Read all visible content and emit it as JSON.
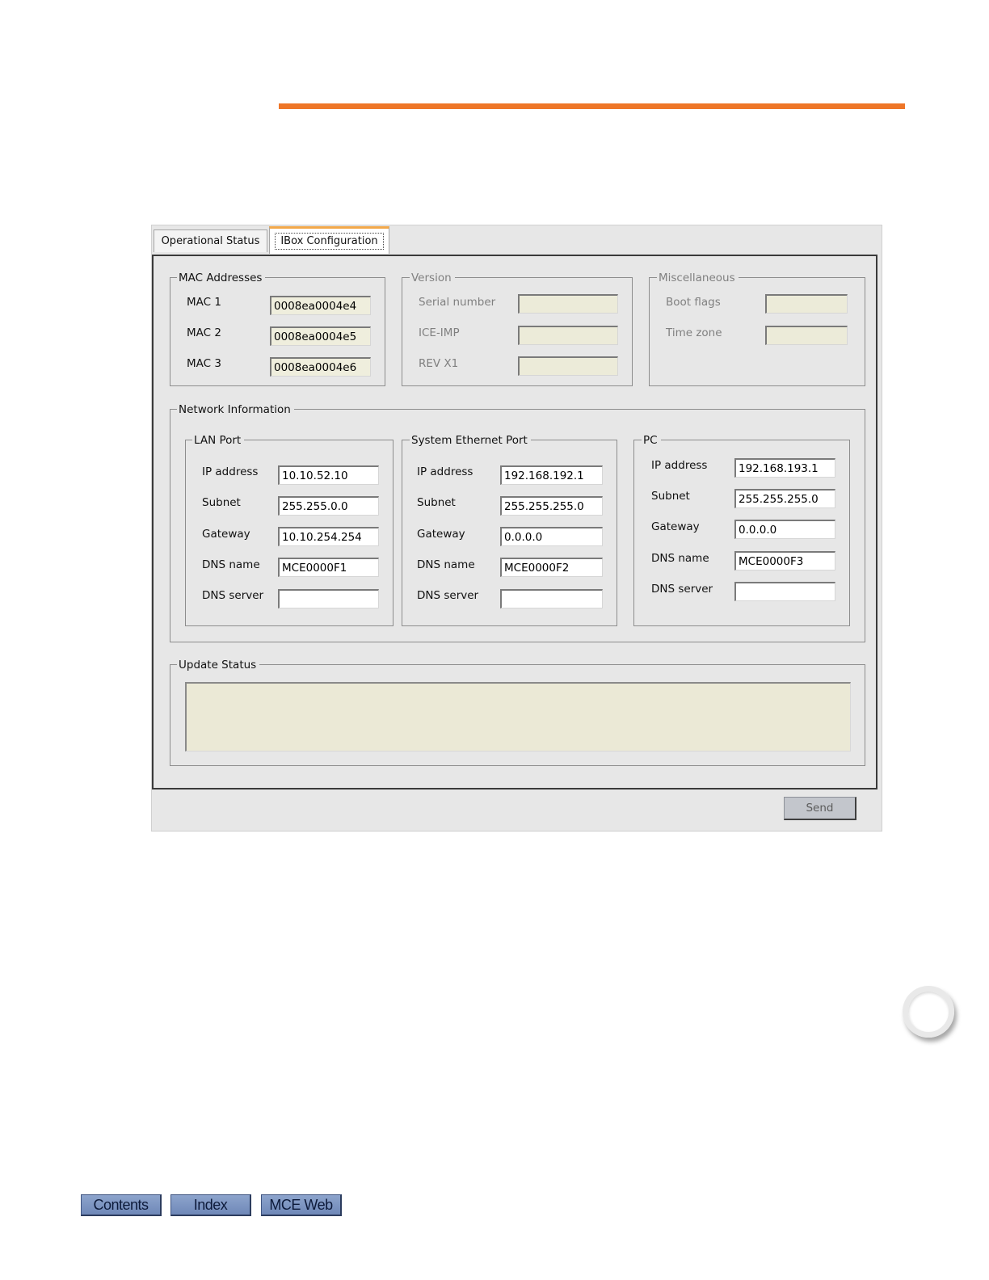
{
  "colors": {
    "accent_rule": "#ee7628",
    "tab_highlight": "#f2a84a",
    "nav_button": "#7b93c0",
    "readonly_field": "#efeedd"
  },
  "tabs": [
    {
      "label": "Operational Status",
      "selected": false
    },
    {
      "label": "IBox Configuration",
      "selected": true
    }
  ],
  "mac": {
    "title": "MAC Addresses",
    "rows": [
      {
        "label": "MAC 1",
        "value": "0008ea0004e4"
      },
      {
        "label": "MAC 2",
        "value": "0008ea0004e5"
      },
      {
        "label": "MAC 3",
        "value": "0008ea0004e6"
      }
    ]
  },
  "version": {
    "title": "Version",
    "rows": [
      {
        "label": "Serial number",
        "value": ""
      },
      {
        "label": "ICE-IMP",
        "value": ""
      },
      {
        "label": "REV X1",
        "value": ""
      }
    ]
  },
  "misc": {
    "title": "Miscellaneous",
    "rows": [
      {
        "label": "Boot flags",
        "value": ""
      },
      {
        "label": "Time zone",
        "value": ""
      }
    ]
  },
  "network": {
    "title": "Network Information",
    "lan": {
      "title": "LAN Port",
      "rows": [
        {
          "label": "IP address",
          "value": "10.10.52.10"
        },
        {
          "label": "Subnet",
          "value": "255.255.0.0"
        },
        {
          "label": "Gateway",
          "value": "10.10.254.254"
        },
        {
          "label": "DNS name",
          "value": "MCE0000F1"
        },
        {
          "label": "DNS server",
          "value": ""
        }
      ]
    },
    "sys": {
      "title": "System Ethernet Port",
      "rows": [
        {
          "label": "IP address",
          "value": "192.168.192.1"
        },
        {
          "label": "Subnet",
          "value": "255.255.255.0"
        },
        {
          "label": "Gateway",
          "value": "0.0.0.0"
        },
        {
          "label": "DNS name",
          "value": "MCE0000F2"
        },
        {
          "label": "DNS server",
          "value": ""
        }
      ]
    },
    "pc": {
      "title": "PC",
      "rows": [
        {
          "label": "IP address",
          "value": "192.168.193.1"
        },
        {
          "label": "Subnet",
          "value": "255.255.255.0"
        },
        {
          "label": "Gateway",
          "value": "0.0.0.0"
        },
        {
          "label": "DNS name",
          "value": "MCE0000F3"
        },
        {
          "label": "DNS server",
          "value": ""
        }
      ]
    }
  },
  "update": {
    "title": "Update Status",
    "text": ""
  },
  "send_label": "Send",
  "nav": {
    "contents": "Contents",
    "index": "Index",
    "mce_web": "MCE Web"
  },
  "icons": {
    "page_ring": "page-ring-icon"
  }
}
